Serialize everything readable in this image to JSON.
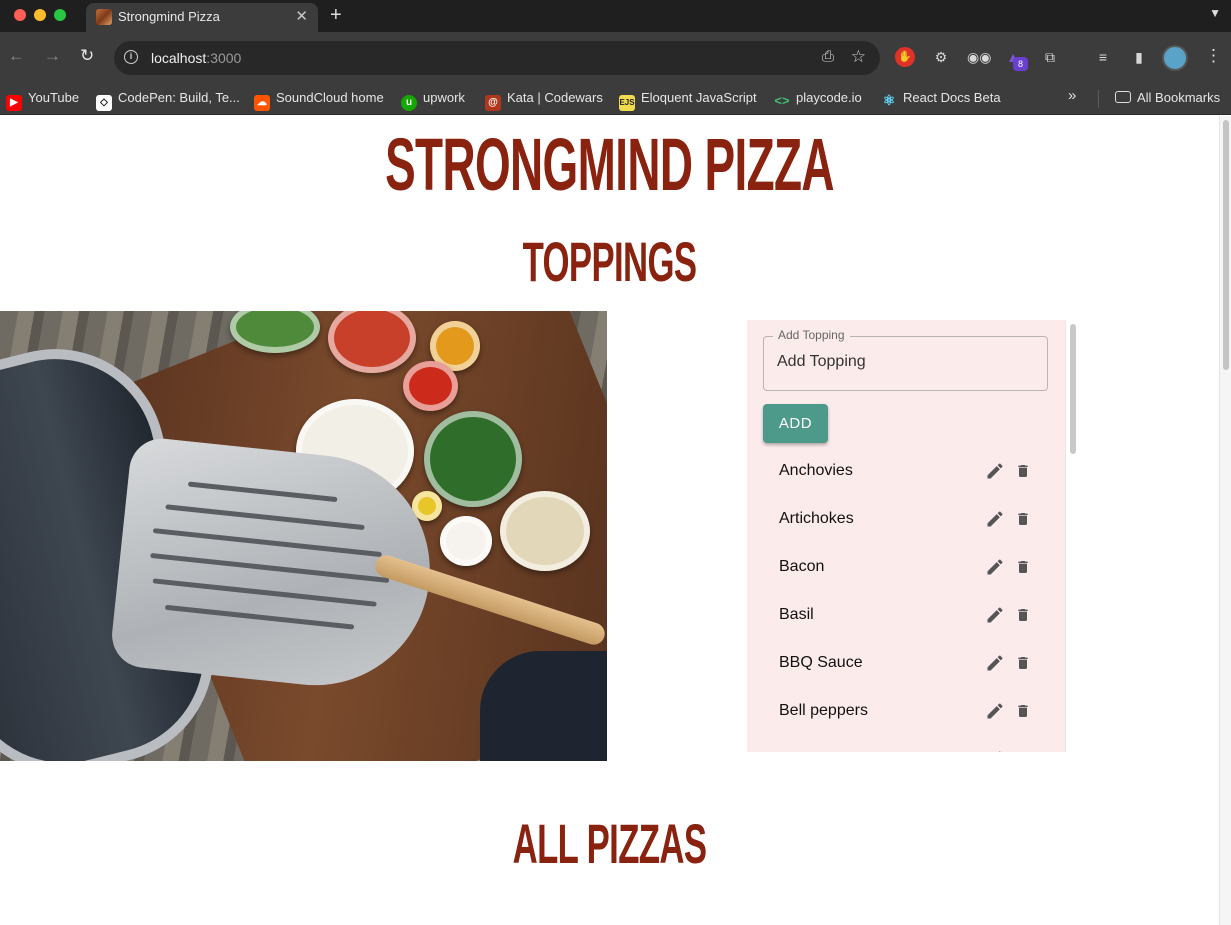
{
  "browser": {
    "tab_title": "Strongmind Pizza",
    "tab_close": "✕",
    "new_tab": "+",
    "address_host": "localhost",
    "address_port": ":3000",
    "extension_badge": "8",
    "bookmarks": [
      {
        "label": "YouTube",
        "icon": "youtube-icon",
        "color": "#ff0000"
      },
      {
        "label": "CodePen: Build, Te...",
        "icon": "codepen-icon",
        "color": "#ffffff"
      },
      {
        "label": "SoundCloud home",
        "icon": "soundcloud-icon",
        "color": "#ff5500"
      },
      {
        "label": "upwork",
        "icon": "upwork-icon",
        "color": "#14a800"
      },
      {
        "label": "Kata | Codewars",
        "icon": "codewars-icon",
        "color": "#b1361e"
      },
      {
        "label": "Eloquent JavaScript",
        "icon": "eloquent-js-icon",
        "color": "#f0db4f"
      },
      {
        "label": "playcode.io",
        "icon": "playcode-icon",
        "color": "#3fbf6f"
      },
      {
        "label": "React Docs Beta",
        "icon": "react-icon",
        "color": "#61dafb"
      }
    ],
    "all_bookmarks": "All Bookmarks"
  },
  "page": {
    "site_title": "STRONGMIND PIZZA",
    "toppings_heading": "TOPPINGS",
    "pizzas_heading": "ALL PIZZAS",
    "accent_color": "#8a2210",
    "panel_color": "#fbeceb",
    "button_color": "#4e9a8a"
  },
  "toppings_form": {
    "legend": "Add Topping",
    "placeholder": "Add Topping",
    "add_label": "ADD"
  },
  "toppings": [
    {
      "name": "Anchovies"
    },
    {
      "name": "Artichokes"
    },
    {
      "name": "Bacon"
    },
    {
      "name": "Basil"
    },
    {
      "name": "BBQ Sauce"
    },
    {
      "name": "Bell peppers"
    }
  ]
}
